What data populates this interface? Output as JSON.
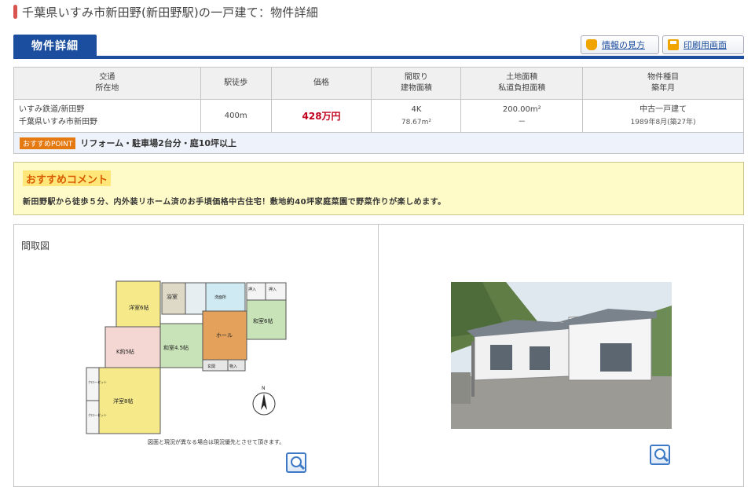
{
  "page": {
    "title": "千葉県いすみ市新田野(新田野駅)の一戸建て：物件詳細"
  },
  "section": {
    "tab": "物件詳細",
    "btn_info": "情報の見方",
    "btn_print": "印刷用画面"
  },
  "table": {
    "headers": [
      {
        "l1": "交通",
        "l2": "所在地"
      },
      {
        "l1": "駅徒歩",
        "l2": ""
      },
      {
        "l1": "価格",
        "l2": ""
      },
      {
        "l1": "間取り",
        "l2": "建物面積"
      },
      {
        "l1": "土地面積",
        "l2": "私道負担面積"
      },
      {
        "l1": "物件種目",
        "l2": "築年月"
      }
    ],
    "row": {
      "transport": "いすみ鉄道/新田野",
      "address": "千葉県いすみ市新田野",
      "walk": "400m",
      "price": "428万円",
      "layout": "4K",
      "building_area": "78.67m²",
      "land_area": "200.00m²",
      "private_road": "－",
      "type": "中古一戸建て",
      "built": "1989年8月(築27年)"
    },
    "point_badge": "おすすめPOINT",
    "point_text": "リフォーム・駐車場2台分・庭10坪以上"
  },
  "comment": {
    "title": "おすすめコメント",
    "text": "新田野駅から徒歩５分、内外装リホーム済のお手頃価格中古住宅！敷地約40坪家庭菜園で野菜作りが楽しめます。"
  },
  "images": {
    "floorplan_label": "間取図",
    "floorplan_note": "図面と現況が異なる場合は現況優先とさせて頂きます。",
    "rooms": [
      "洋室6帖",
      "浴室",
      "洗面所",
      "押入",
      "押入",
      "和室6帖",
      "和室4.5帖",
      "ホール",
      "K約5帖",
      "玄関",
      "物入",
      "洋室8帖",
      "クローゼット",
      "クローゼット",
      "N"
    ]
  }
}
